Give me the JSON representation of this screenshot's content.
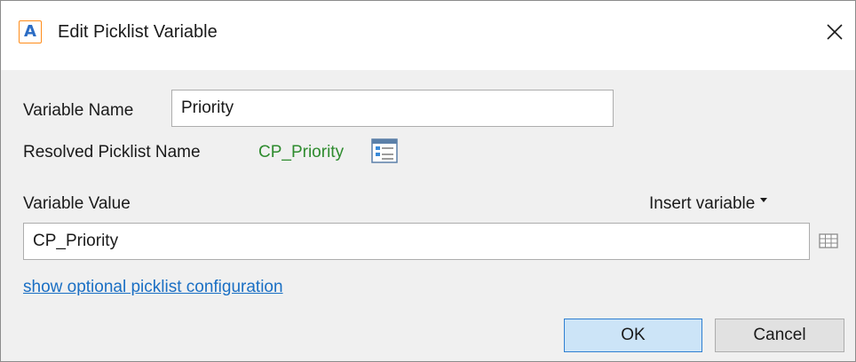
{
  "window": {
    "app_icon_letter": "A",
    "title": "Edit Picklist Variable"
  },
  "form": {
    "variable_name_label": "Variable Name",
    "variable_name_value": "Priority",
    "resolved_label": "Resolved Picklist Name",
    "resolved_value": "CP_Priority",
    "variable_value_label": "Variable Value",
    "insert_variable_label": "Insert variable",
    "variable_value": "CP_Priority",
    "optional_config_link": "show optional picklist configuration"
  },
  "buttons": {
    "ok_label": "OK",
    "cancel_label": "Cancel"
  },
  "colors": {
    "resolved_green": "#2e8b2e",
    "link_blue": "#1a6fc4",
    "ok_fill": "#cce4f7",
    "ok_border": "#2f7fd1",
    "app_icon_orange": "#ff8c1a"
  },
  "icons": {
    "close": "close-icon",
    "picklist": "picklist-icon",
    "table": "table-icon",
    "dropdown": "chevron-down-icon"
  }
}
